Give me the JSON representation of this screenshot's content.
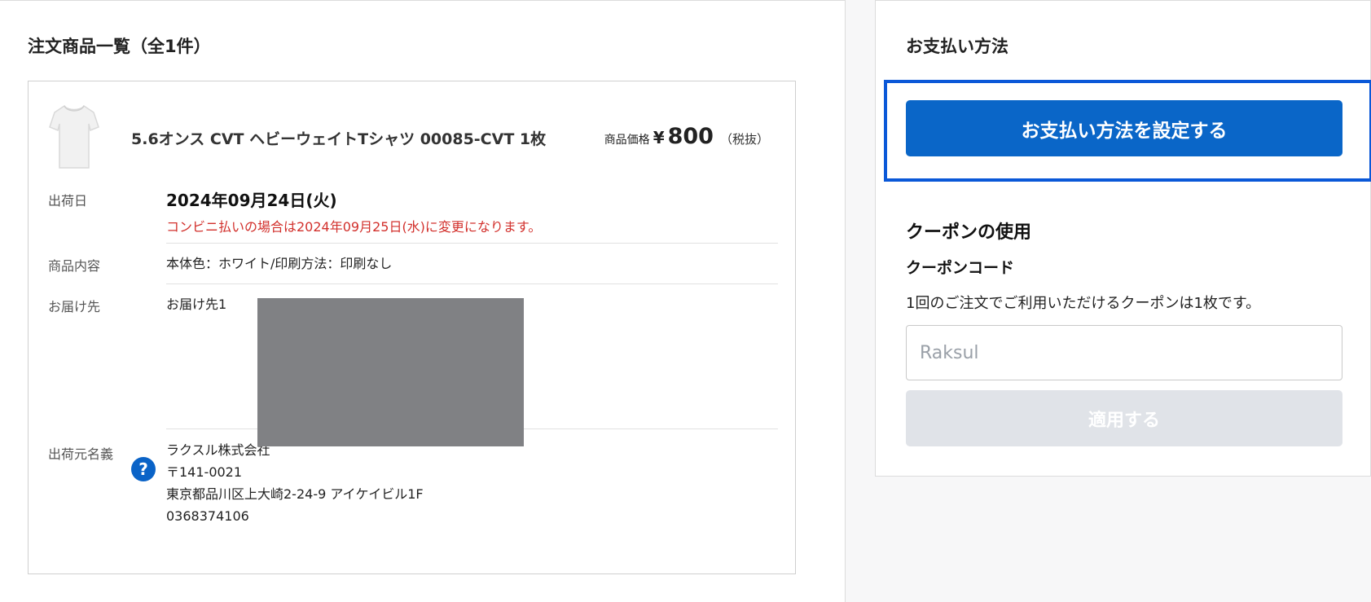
{
  "order_list": {
    "title": "注文商品一覧（全1件）",
    "item": {
      "name": "5.6オンス CVT ヘビーウェイトTシャツ 00085-CVT 1枚",
      "price_label": "商品価格",
      "price_currency": "¥",
      "price_value": "800",
      "price_tax": "（税抜）",
      "details": {
        "ship_date_label": "出荷日",
        "ship_date": "2024年09月24日(火)",
        "ship_date_note": "コンビニ払いの場合は2024年09月25日(水)に変更になります。",
        "content_label": "商品内容",
        "content_value": "本体色：ホワイト/印刷方法：印刷なし",
        "destination_label": "お届け先",
        "destination_value": "お届け先1",
        "sender_label": "出荷元名義",
        "sender_help_icon": "question-circle-icon",
        "sender_name": "ラクスル株式会社",
        "sender_postal": "〒141-0021",
        "sender_address": "東京都品川区上大崎2-24-9 アイケイビル1F",
        "sender_phone": "0368374106"
      }
    }
  },
  "payment": {
    "title": "お支払い方法",
    "set_button_label": "お支払い方法を設定する",
    "accent_color": "#0a66c8"
  },
  "coupon": {
    "title": "クーポンの使用",
    "code_label": "クーポンコード",
    "note": "1回のご注文でご利用いただけるクーポンは1枚です。",
    "input_placeholder": "Raksul",
    "input_value": "",
    "apply_button_label": "適用する"
  }
}
